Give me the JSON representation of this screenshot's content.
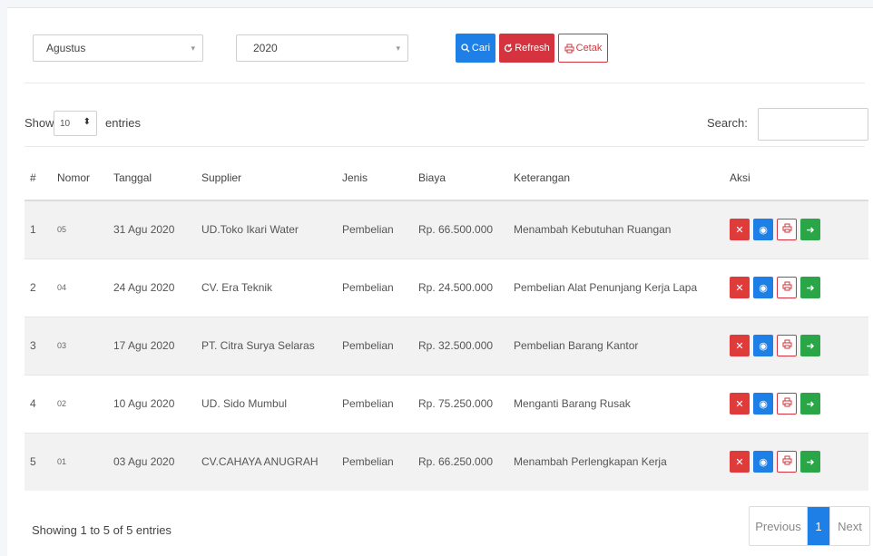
{
  "filters": {
    "month": "Agustus",
    "year": "2020",
    "caret": "▾",
    "cari_label": "Cari",
    "refresh_label": "Refresh",
    "cetak_label": "Cetak"
  },
  "length": {
    "show_label": "Show",
    "value": "10",
    "entries_label": "entries",
    "search_label": "Search:"
  },
  "table": {
    "headers": [
      "#",
      "Nomor",
      "Tanggal",
      "Supplier",
      "Jenis",
      "Biaya",
      "Keterangan",
      "Aksi"
    ],
    "rows": [
      {
        "no": "1",
        "nomor": "05",
        "tanggal": "31 Agu 2020",
        "supplier": "UD.Toko Ikari Water",
        "jenis": "Pembelian",
        "biaya": "Rp. 66.500.000",
        "keterangan": "Menambah Kebutuhan Ruangan"
      },
      {
        "no": "2",
        "nomor": "04",
        "tanggal": "24 Agu 2020",
        "supplier": "CV. Era Teknik",
        "jenis": "Pembelian",
        "biaya": "Rp. 24.500.000",
        "keterangan": "Pembelian Alat Penunjang Kerja Lapa"
      },
      {
        "no": "3",
        "nomor": "03",
        "tanggal": "17 Agu 2020",
        "supplier": "PT. Citra Surya Selaras",
        "jenis": "Pembelian",
        "biaya": "Rp. 32.500.000",
        "keterangan": "Pembelian Barang Kantor"
      },
      {
        "no": "4",
        "nomor": "02",
        "tanggal": "10 Agu 2020",
        "supplier": "UD. Sido Mumbul",
        "jenis": "Pembelian",
        "biaya": "Rp. 75.250.000",
        "keterangan": "Menganti Barang Rusak"
      },
      {
        "no": "5",
        "nomor": "01",
        "tanggal": "03 Agu 2020",
        "supplier": "CV.CAHAYA ANUGRAH",
        "jenis": "Pembelian",
        "biaya": "Rp. 66.250.000",
        "keterangan": "Menambah Perlengkapan Kerja"
      }
    ]
  },
  "footer": {
    "info": "Showing 1 to 5 of 5 entries",
    "previous": "Previous",
    "page": "1",
    "next": "Next"
  },
  "colors": {
    "primary": "#1e7fe6",
    "danger": "#d5343f",
    "success": "#2aa648"
  }
}
